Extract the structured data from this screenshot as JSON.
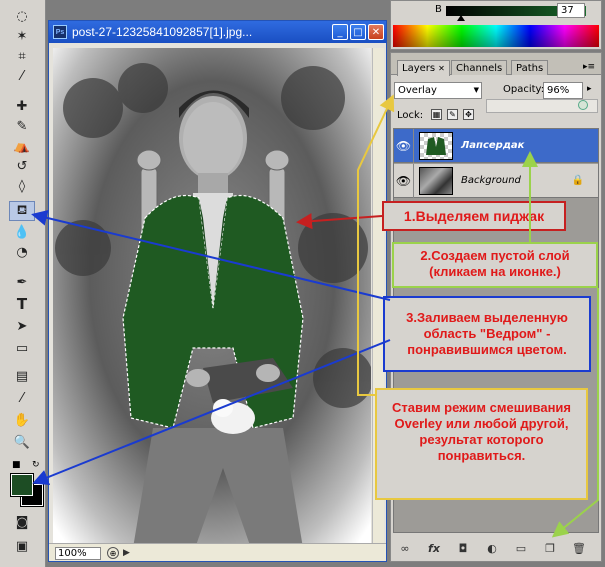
{
  "document": {
    "title": "post-27-12325841092857[1].jpg...",
    "app_icon": "Ps",
    "zoom": "100%"
  },
  "color_panel": {
    "channel_label": "B",
    "channel_value": "37"
  },
  "layers_panel": {
    "tabs": [
      {
        "label": "Layers",
        "active": true
      },
      {
        "label": "Channels",
        "active": false
      },
      {
        "label": "Paths",
        "active": false
      }
    ],
    "blend_mode": "Overlay",
    "opacity_label": "Opacity:",
    "opacity_value": "96%",
    "lock_label": "Lock:",
    "layers": [
      {
        "name": "Лапсердак",
        "selected": true
      },
      {
        "name": "Background",
        "selected": false
      }
    ]
  },
  "tool_colors": {
    "foreground": "#1d4d24",
    "background": "#000000"
  },
  "annotations": {
    "step1": "1.Выделяем пиджак",
    "step2": "2.Создаем пустой слой (кликаем на иконке.)",
    "step3": "3.Заливаем выделенную область \"Ведром\" - понравившимся цветом.",
    "step4": "Ставим режим смешивания Overley или любой другой, результат которого понравиться."
  }
}
